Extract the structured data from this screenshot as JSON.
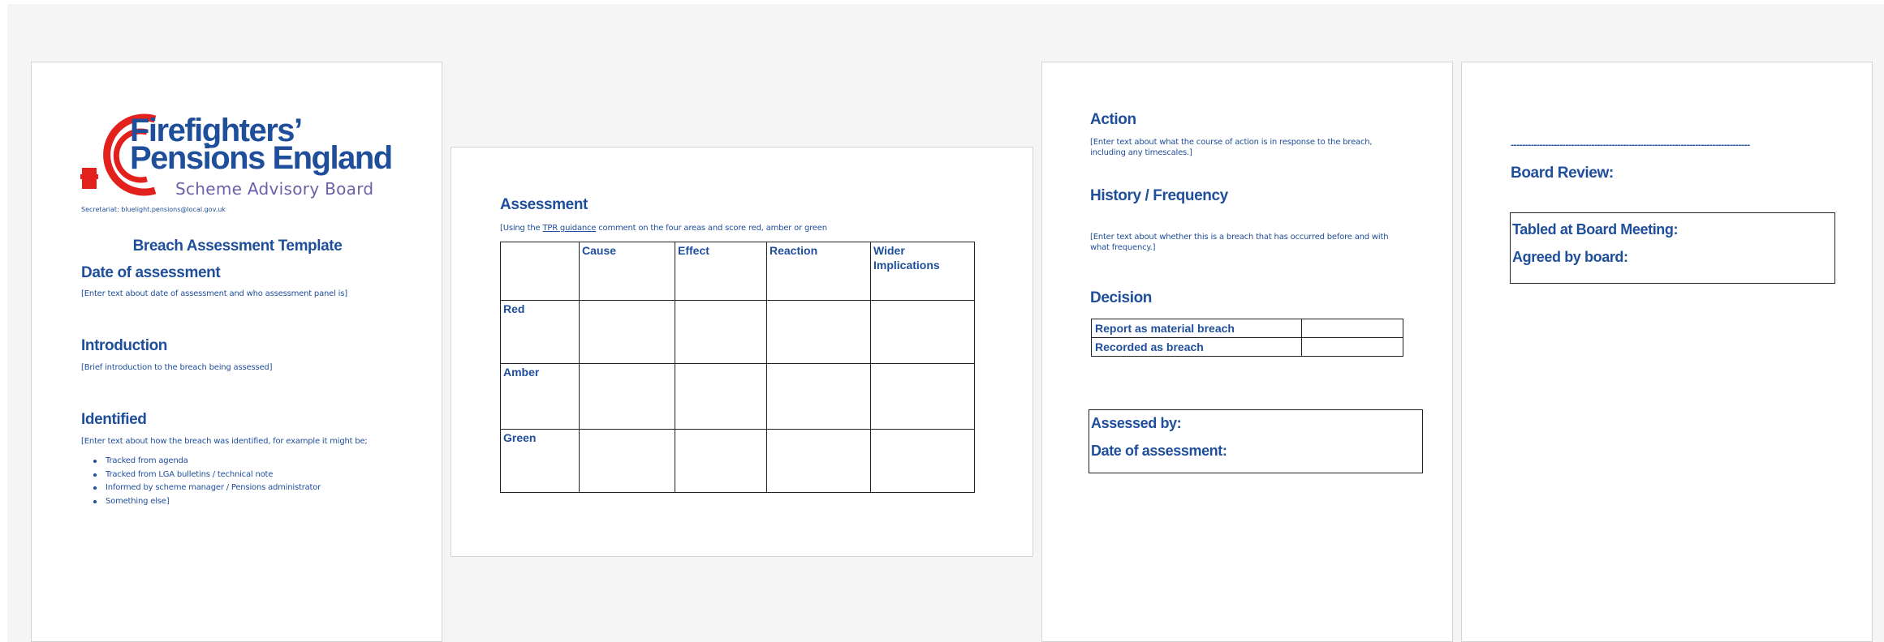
{
  "page1": {
    "logo": {
      "line1": "Firefighters’",
      "line2": "Pensions England",
      "line3": "Scheme Advisory Board"
    },
    "secretariat": "Secretariat: bluelight.pensions@local.gov.uk",
    "title": "Breach Assessment Template",
    "sections": [
      {
        "heading": "Date of assessment",
        "text": "[Enter text about date of assessment and who assessment panel is]"
      },
      {
        "heading": "Introduction",
        "text": "[Brief introduction to the breach being assessed]"
      },
      {
        "heading": "Identified",
        "text": "[Enter text about how the breach was identified, for example it might be;"
      }
    ],
    "bullets": [
      "Tracked from agenda",
      "Tracked from LGA bulletins / technical note",
      "Informed by scheme manager / Pensions administrator",
      "Something else]"
    ]
  },
  "page2": {
    "heading": "Assessment",
    "intro_prefix": "[Using the ",
    "intro_link": "TPR guidance",
    "intro_suffix": " comment on the four areas and score red, amber or green",
    "columns": [
      "",
      "Cause",
      "Effect",
      "Reaction",
      "Wider Implications"
    ],
    "rows": [
      "Red",
      "Amber",
      "Green"
    ]
  },
  "page3": {
    "action_heading": "Action",
    "action_text": "[Enter text about what the course of action is in response to the breach, including any timescales.]",
    "history_heading": "History / Frequency",
    "history_text": "[Enter text about whether this is a breach that has occurred before and with what frequency.]",
    "decision_heading": "Decision",
    "decision_rows": [
      {
        "label": "Report as material breach",
        "value": ""
      },
      {
        "label": "Recorded as breach",
        "value": ""
      }
    ],
    "assessed_by": "Assessed by:",
    "date_of_assessment": "Date of assessment:"
  },
  "page4": {
    "dashes": "-----------------------------------------------------------------------------------",
    "board_review": "Board Review:",
    "tabled": "Tabled at Board Meeting:",
    "agreed": "Agreed by board:"
  },
  "colors": {
    "text": "#1f4e9a",
    "logo_red": "#e2211c",
    "logo_purple": "#6e5fa8",
    "background": "#f5f5f5"
  }
}
